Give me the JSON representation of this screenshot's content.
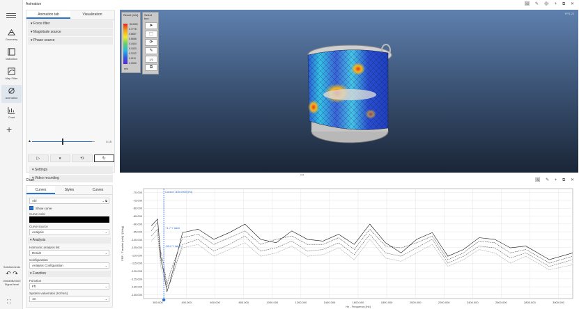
{
  "rail": {
    "items": [
      {
        "label": "Geometry",
        "icon": "geometry-icon"
      },
      {
        "label": "Validation",
        "icon": "validation-icon"
      },
      {
        "label": "Map Filter",
        "icon": "map-filter-icon"
      },
      {
        "label": "Animation",
        "icon": "animation-icon"
      },
      {
        "label": "Chart",
        "icon": "chart-icon"
      }
    ],
    "undo_label": "Solution/undo",
    "memory": "0000MB/0000",
    "signal_label": "Signal level"
  },
  "top": {
    "title": "Animation",
    "window_icons": "🖼 ✎ ⚙ + ⧉ ✕",
    "tabs": [
      "Animation tab",
      "Visualization"
    ],
    "sections": [
      "Force filter",
      "Magnitude source",
      "Phase source"
    ],
    "slider_value": "0.15",
    "slider_fraction": 0.5,
    "play_buttons": [
      "▷",
      "⏸",
      "⟲",
      "↻"
    ],
    "bottom_sections": [
      "Settings",
      "Video recording"
    ]
  },
  "viewport": {
    "legend_title": "Result",
    "legend_unit": "[m/s]",
    "legend_ticks": [
      "+8.0000",
      "0.7778",
      "0.6667",
      "0.5556",
      "0.4444",
      "0.3333",
      "0.2222",
      "0.1111",
      "0.0000"
    ],
    "legend_footer": "m/s",
    "toolbox_title": "Select box",
    "tools": [
      "➤",
      "⬚",
      "⟳",
      "✎",
      "1/1",
      "⧉"
    ],
    "fps": "FPS 22",
    "colors": {
      "bg_top": "#5f80ae",
      "bg_bottom": "#1a2536"
    }
  },
  "bottom": {
    "title": "Chart",
    "window_icons": "🖼 ✎ + ⧉ ✕",
    "tabs": [
      "Curves",
      "Styles",
      "Curves"
    ],
    "search_value": "Abl",
    "show_curve_label": "Show curve",
    "curve_color_label": "Curve color",
    "curve_source_label": "Curve source",
    "curve_source_value": "Analysis",
    "analysis_header": "Analysis",
    "analysis_sub": "Harmonic analysis list",
    "analysis_value": "Result",
    "configuration_label": "Configuration",
    "configuration_value": "Analysis Configuration",
    "function_header": "Function",
    "function_label": "Function",
    "function_value": "Fft",
    "system_label": "System value/ratio (Hz/m/s)",
    "system_value": "10"
  },
  "chart_data": {
    "type": "line",
    "ylabel": "FRF - Transfer [m/s] / [N/kg]",
    "xlabel": "Hz - Frequency [Hz]",
    "cursor_label_top": "Cursor: 300.0000 [Hz]",
    "cursor_label_mid": "+1.7 Y label",
    "cursor_label_low": "-53.2 Y label",
    "yticks": [
      "-70.000",
      "-75.000",
      "-80.000",
      "-85.000",
      "-90.000",
      "-95.000",
      "-100.000",
      "-105.000",
      "-110.000",
      "-115.000",
      "-120.000",
      "-125.000",
      "-130.000",
      "-135.000"
    ],
    "xticks": [
      "300.000",
      "400.000",
      "600.000",
      "800.000",
      "1000.000",
      "1200.000",
      "1400.000",
      "1600.000",
      "1800.000",
      "2000.000",
      "2200.000",
      "2400.000",
      "2600.000",
      "2800.000",
      "3000.000"
    ],
    "cursor_x": 380,
    "series": [
      {
        "values": [
          -92,
          -88,
          -110,
          -120,
          -131,
          -125,
          -96,
          -94,
          -100,
          -96,
          -91,
          -100,
          -102,
          -95,
          -100,
          -101,
          -97,
          -103,
          -91,
          -102,
          -108,
          -100,
          -96,
          -110,
          -106,
          -99,
          -100,
          -105,
          -104,
          -112,
          -108
        ]
      },
      {
        "values": [
          -95,
          -90,
          -107,
          -115,
          -127,
          -120,
          -99,
          -97,
          -103,
          -99,
          -95,
          -103,
          -100,
          -98,
          -103,
          -103,
          -99,
          -106,
          -94,
          -104,
          -105,
          -102,
          -98,
          -112,
          -108,
          -101,
          -102,
          -108,
          -106,
          -114,
          -110
        ]
      },
      {
        "values": [
          -98,
          -94,
          -113,
          -118,
          -128,
          -126,
          -103,
          -100,
          -107,
          -103,
          -98,
          -107,
          -105,
          -101,
          -107,
          -106,
          -102,
          -109,
          -97,
          -108,
          -110,
          -105,
          -100,
          -114,
          -110,
          -104,
          -105,
          -111,
          -108,
          -116,
          -112
        ]
      },
      {
        "values": [
          -101,
          -97,
          -116,
          -122,
          -125,
          -123,
          -105,
          -103,
          -110,
          -106,
          -102,
          -110,
          -108,
          -104,
          -110,
          -109,
          -105,
          -112,
          -100,
          -111,
          -113,
          -108,
          -103,
          -116,
          -112,
          -106,
          -108,
          -114,
          -110,
          -118,
          -115
        ]
      }
    ],
    "x": [
      300,
      340,
      360,
      380,
      400,
      420,
      500,
      600,
      700,
      800,
      900,
      1000,
      1100,
      1200,
      1300,
      1400,
      1500,
      1600,
      1700,
      1800,
      1900,
      2000,
      2100,
      2200,
      2300,
      2400,
      2500,
      2600,
      2700,
      2850,
      3000
    ],
    "ylim": [
      -135,
      -70
    ],
    "xlim": [
      250,
      3000
    ]
  }
}
